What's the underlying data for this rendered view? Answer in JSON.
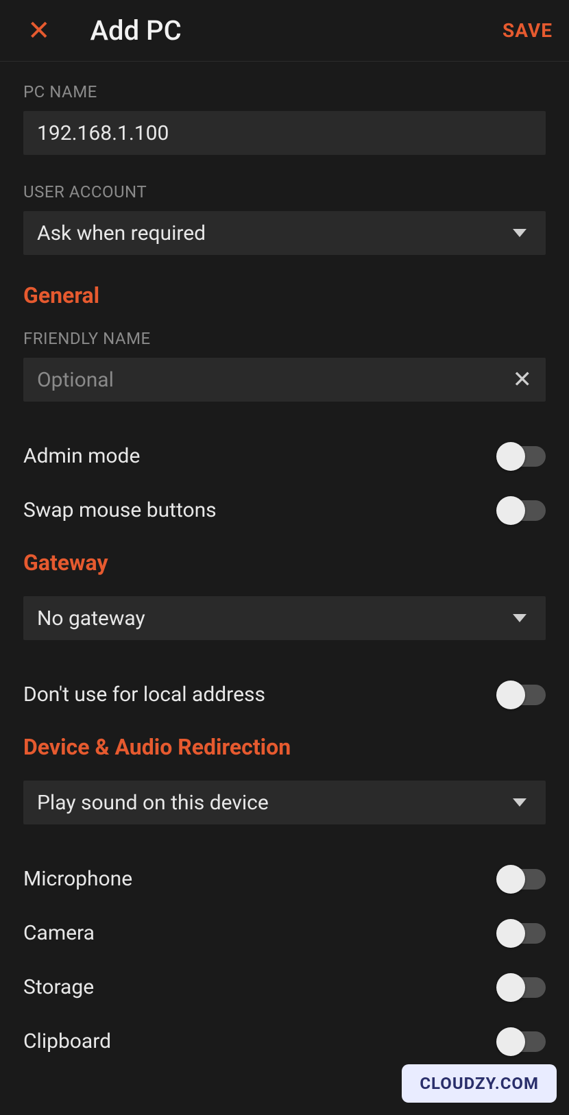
{
  "header": {
    "title": "Add PC",
    "save": "SAVE"
  },
  "pc_name": {
    "label": "PC NAME",
    "value": "192.168.1.100"
  },
  "user_account": {
    "label": "USER ACCOUNT",
    "value": "Ask when required"
  },
  "sections": {
    "general": "General",
    "gateway": "Gateway",
    "device_audio": "Device & Audio Redirection"
  },
  "friendly_name": {
    "label": "FRIENDLY NAME",
    "placeholder": "Optional"
  },
  "toggles": {
    "admin_mode": "Admin mode",
    "swap_mouse": "Swap mouse buttons",
    "no_local": "Don't use for local address",
    "microphone": "Microphone",
    "camera": "Camera",
    "storage": "Storage",
    "clipboard": "Clipboard"
  },
  "gateway": {
    "value": "No gateway"
  },
  "audio": {
    "value": "Play sound on this device"
  },
  "watermark": "CLOUDZY.COM"
}
